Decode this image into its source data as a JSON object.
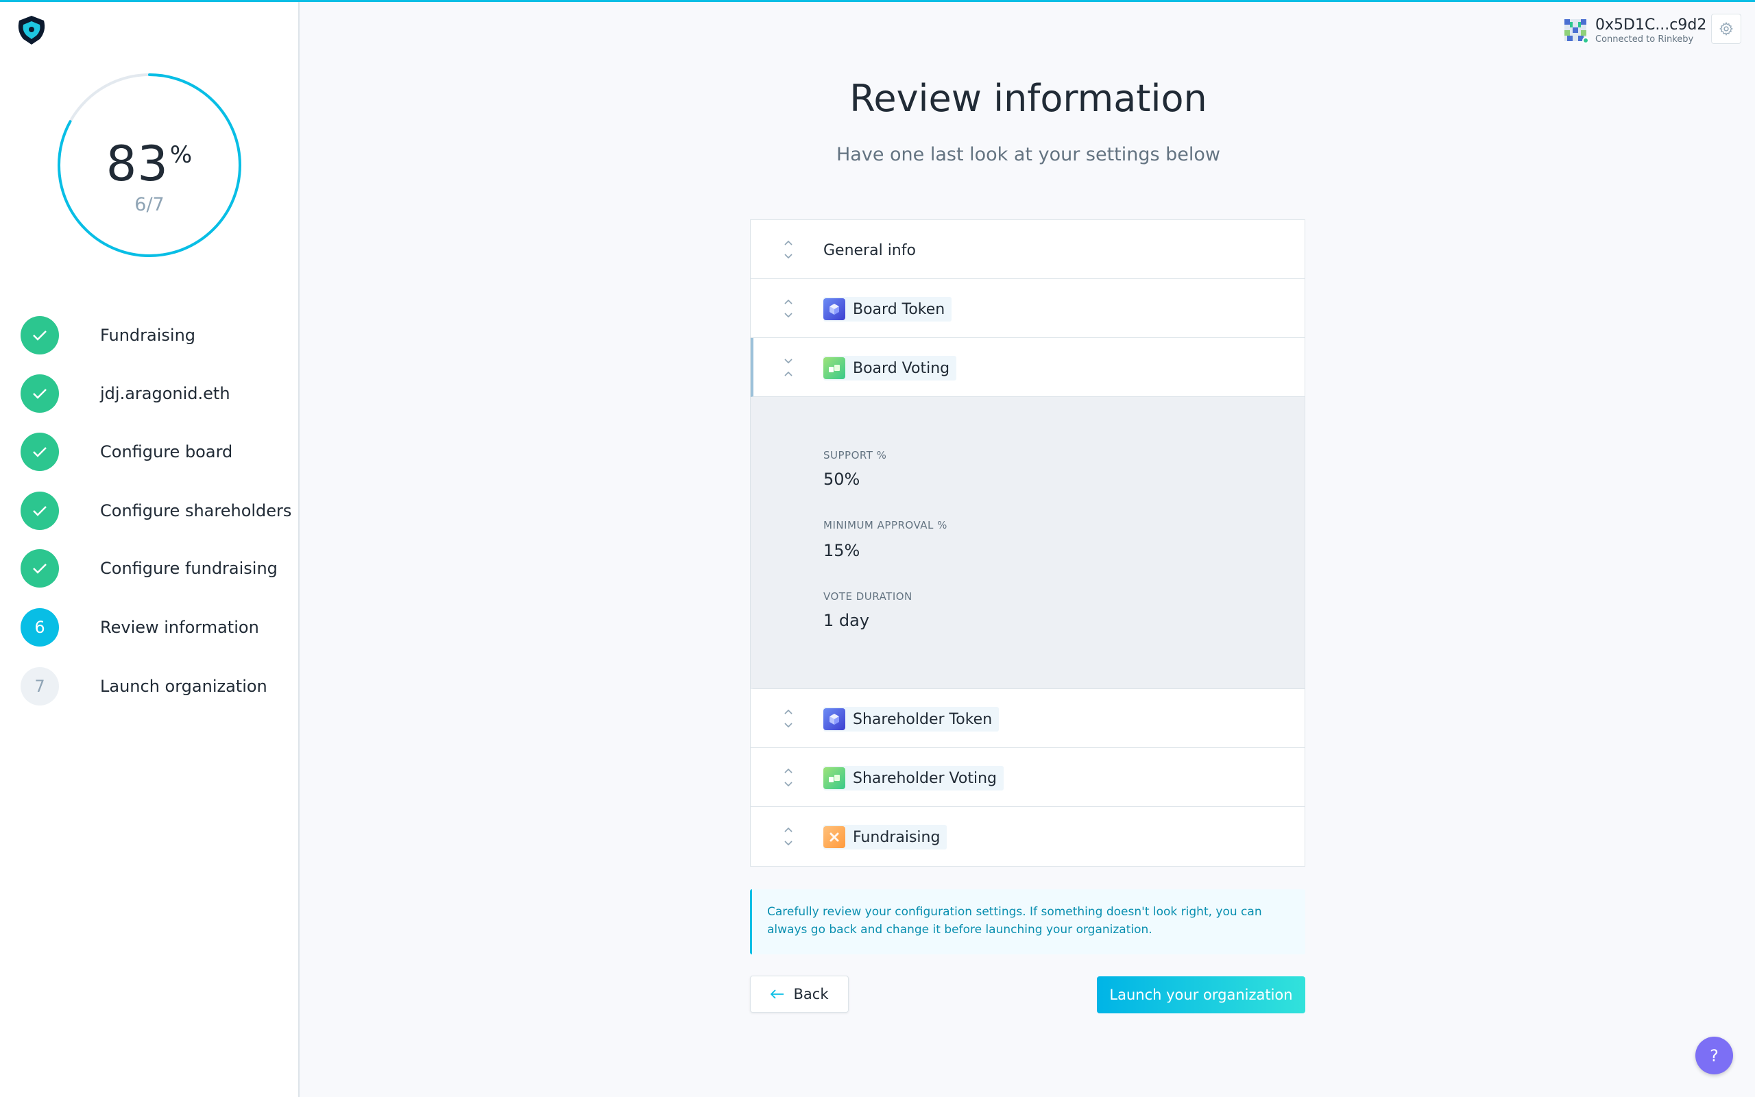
{
  "colors": {
    "accent": "#08bee5",
    "success": "#2cc68f",
    "help": "#7c6ff5",
    "info_text": "#0a8fb0"
  },
  "progress": {
    "value": "83",
    "symbol": "%",
    "fraction": 0.83,
    "count": "6/7"
  },
  "steps": [
    {
      "number": "1",
      "label": "Fundraising",
      "status": "done"
    },
    {
      "number": "2",
      "label": "jdj.aragonid.eth",
      "status": "done"
    },
    {
      "number": "3",
      "label": "Configure board",
      "status": "done"
    },
    {
      "number": "4",
      "label": "Configure shareholders",
      "status": "done"
    },
    {
      "number": "5",
      "label": "Configure fundraising",
      "status": "done"
    },
    {
      "number": "6",
      "label": "Review information",
      "status": "active"
    },
    {
      "number": "7",
      "label": "Launch organization",
      "status": "pending"
    }
  ],
  "account": {
    "address": "0x5D1C...c9d2",
    "network": "Connected to Rinkeby",
    "icons": {
      "settings": "gear-icon",
      "identicon": "identicon"
    }
  },
  "page": {
    "title": "Review information",
    "subtitle": "Have one last look at your settings below"
  },
  "sections": [
    {
      "label": "General info",
      "icon": "none",
      "expanded": false
    },
    {
      "label": "Board Token",
      "icon": "token-cube-icon",
      "expanded": false
    },
    {
      "label": "Board Voting",
      "icon": "voting-thumbs-icon",
      "expanded": true
    },
    {
      "label": "Shareholder Token",
      "icon": "token-cube-icon",
      "expanded": false
    },
    {
      "label": "Shareholder Voting",
      "icon": "voting-thumbs-icon",
      "expanded": false
    },
    {
      "label": "Fundraising",
      "icon": "fundraising-icon",
      "expanded": false
    }
  ],
  "board_voting": {
    "support_label": "SUPPORT %",
    "support_value": "50%",
    "approval_label": "MINIMUM APPROVAL %",
    "approval_value": "15%",
    "duration_label": "VOTE DURATION",
    "duration_value": "1 day"
  },
  "info": {
    "text": "Carefully review your configuration settings. If something doesn't look right, you can always go back and change it before launching your organization."
  },
  "actions": {
    "back_label": "Back",
    "launch_label": "Launch your organization",
    "help_label": "?"
  }
}
